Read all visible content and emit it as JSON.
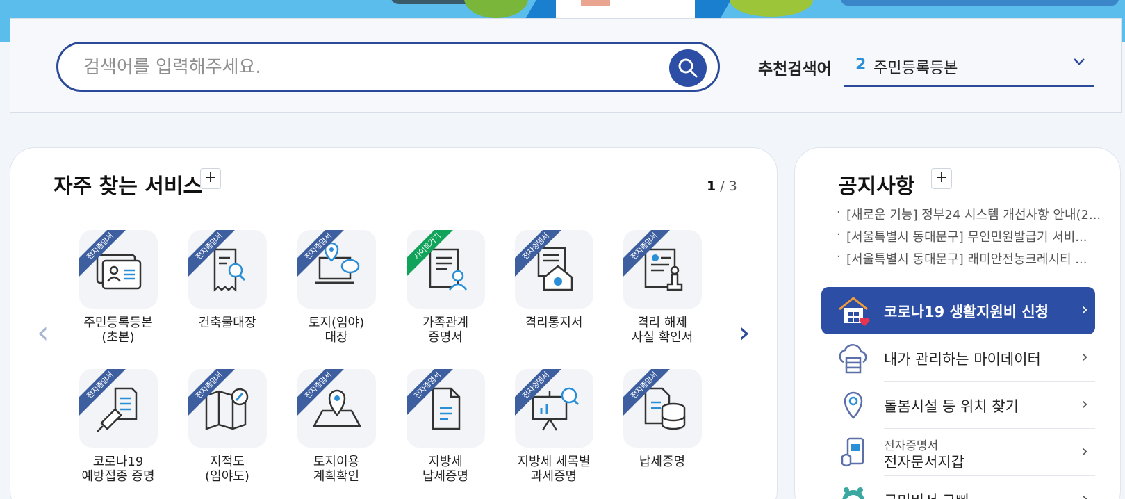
{
  "colors": {
    "brand_blue": "#2c4ea4",
    "rank_blue": "#2a8fd6",
    "ribbon_blue": "#3d5fa0",
    "ribbon_green": "#12a35b",
    "hero_sky": "#5bbdeb"
  },
  "search": {
    "placeholder": "검색어를 입력해주세요.",
    "recommended_label": "추천검색어",
    "recommended_rank": "2",
    "recommended_term": "주민등록등본"
  },
  "services": {
    "title": "자주 찾는 서비스",
    "add": "+",
    "page_current": "1",
    "page_total": "/ 3",
    "prev": "‹",
    "next": "›",
    "items": [
      {
        "label": "주민등록등본\n(초본)",
        "badge": "전자증명서",
        "icon": "id-card-icon"
      },
      {
        "label": "건축물대장",
        "badge": "전자증명서",
        "icon": "receipt-search-icon"
      },
      {
        "label": "토지(임야)\n대장",
        "badge": "전자증명서",
        "icon": "laptop-location-icon"
      },
      {
        "label": "가족관계\n증명서",
        "badge": "사이트가기",
        "icon": "document-person-icon"
      },
      {
        "label": "격리통지서",
        "badge": "전자증명서",
        "icon": "house-virus-icon"
      },
      {
        "label": "격리 해제\n사실 확인서",
        "badge": "전자증명서",
        "icon": "document-stamp-icon"
      },
      {
        "label": "코로나19\n예방접종 증명",
        "badge": "전자증명서",
        "icon": "vaccine-icon"
      },
      {
        "label": "지적도\n(임야도)",
        "badge": "전자증명서",
        "icon": "map-compass-icon"
      },
      {
        "label": "토지이용\n계획확인",
        "badge": "전자증명서",
        "icon": "map-pin-icon"
      },
      {
        "label": "지방세\n납세증명",
        "badge": "전자증명서",
        "icon": "document-icon"
      },
      {
        "label": "지방세 세목별\n과세증명",
        "badge": "전자증명서",
        "icon": "presentation-search-icon"
      },
      {
        "label": "납세증명",
        "badge": "전자증명서",
        "icon": "document-database-icon"
      }
    ]
  },
  "notices": {
    "title": "공지사항",
    "add": "+",
    "items": [
      "[새로운 기능] 정부24 시스템 개선사항 안내(2...",
      "[서울특별시 동대문구] 무인민원발급기 서비...",
      "[서울특별시 동대문구] 래미안전농크레시티 ..."
    ]
  },
  "quick_links": [
    {
      "label": "코로나19 생활지원비 신청",
      "icon": "house-heart-icon",
      "highlight": true
    },
    {
      "label": "내가 관리하는 마이데이터",
      "icon": "cloud-data-icon"
    },
    {
      "label": "돌봄시설 등 위치 찾기",
      "icon": "location-pin-icon"
    },
    {
      "sub": "전자증명서",
      "label": "전자문서지갑",
      "icon": "mobile-wallet-icon"
    },
    {
      "label": "국민비서 구삐",
      "icon": "robot-icon"
    }
  ],
  "chevron": "›"
}
